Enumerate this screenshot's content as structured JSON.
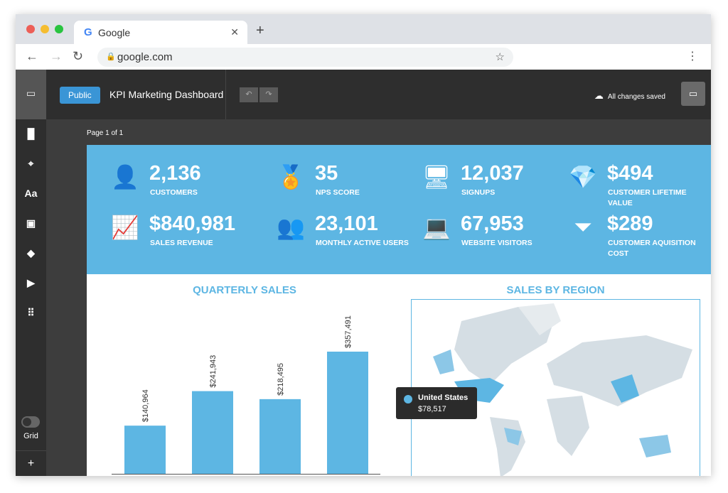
{
  "browser": {
    "tab_title": "Google",
    "url": "google.com"
  },
  "header": {
    "visibility": "Public",
    "title": "KPI Marketing Dashboard",
    "save_status": "All changes saved"
  },
  "sidebar": {
    "grid_label": "Grid"
  },
  "page_indicator": "Page 1 of 1",
  "kpis": [
    {
      "value": "2,136",
      "label": "CUSTOMERS",
      "icon": "customer-icon"
    },
    {
      "value": "35",
      "label": "NPS SCORE",
      "icon": "medal-icon"
    },
    {
      "value": "12,037",
      "label": "SIGNUPS",
      "icon": "signup-monitor-icon"
    },
    {
      "value": "$494",
      "label": "CUSTOMER LIFETIME VALUE",
      "icon": "diamond-icon"
    },
    {
      "value": "$840,981",
      "label": "SALES REVENUE",
      "icon": "revenue-growth-icon"
    },
    {
      "value": "23,101",
      "label": "MONTHLY ACTIVE USERS",
      "icon": "users-group-icon"
    },
    {
      "value": "67,953",
      "label": "WEBSITE VISITORS",
      "icon": "laptop-globe-icon"
    },
    {
      "value": "$289",
      "label": "CUSTOMER AQUISITION COST",
      "icon": "funnel-icon"
    }
  ],
  "colors": {
    "accent": "#5db6e3",
    "bar": "#5db6e3"
  },
  "chart_data": [
    {
      "type": "bar",
      "title": "QUARTERLY SALES",
      "values": [
        140964,
        241943,
        218495,
        357491
      ],
      "data_labels": [
        "$140,964",
        "$241,943",
        "$218,495",
        "$357,491"
      ]
    },
    {
      "type": "map",
      "title": "SALES BY REGION",
      "tooltip": {
        "country": "United States",
        "value": "$78,517"
      }
    }
  ]
}
